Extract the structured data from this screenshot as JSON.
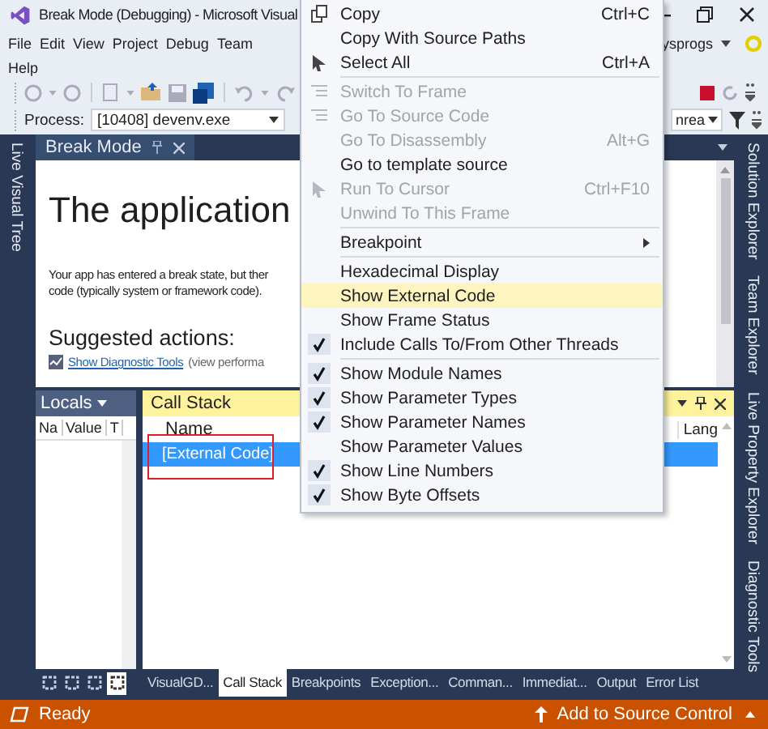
{
  "window": {
    "title": "Break Mode (Debugging) - Microsoft Visual"
  },
  "menu_bar": {
    "items": [
      "File",
      "Edit",
      "View",
      "Project",
      "Debug",
      "Team",
      "Help"
    ],
    "account": "ysprogs"
  },
  "toolbar": {
    "process_label": "Process:",
    "process_value": "[10408] devenv.exe",
    "thread_value": "nrea"
  },
  "left_tool_tabs": [
    "Live Visual Tree"
  ],
  "document": {
    "tab": "Break Mode",
    "heading": "The application",
    "paragraph_lines": [
      "Your app has entered a break state, but ther",
      "code (typically system or framework code)."
    ],
    "subheading": "Suggested actions:",
    "link": "Show Diagnostic Tools",
    "link_note": "(view performa"
  },
  "locals": {
    "title": "Locals",
    "columns": [
      "Na",
      "Value",
      "T"
    ],
    "tabs": [
      {
        "selected": false
      },
      {
        "selected": false
      },
      {
        "selected": false
      },
      {
        "selected": true
      }
    ]
  },
  "call_stack": {
    "title": "Call Stack",
    "columns": [
      "Name",
      "Lang"
    ],
    "rows": [
      {
        "name": "[External Code]",
        "selected": true,
        "outlined": true
      }
    ]
  },
  "bottom_tabs": [
    {
      "label": "VisualGD...",
      "selected": false
    },
    {
      "label": "Call Stack",
      "selected": true
    },
    {
      "label": "Breakpoints",
      "selected": false
    },
    {
      "label": "Exception...",
      "selected": false
    },
    {
      "label": "Comman...",
      "selected": false
    },
    {
      "label": "Immediat...",
      "selected": false
    },
    {
      "label": "Output",
      "selected": false
    },
    {
      "label": "Error List",
      "selected": false
    }
  ],
  "right_tool_tabs": [
    "Solution Explorer",
    "Team Explorer",
    "Live Property Explorer",
    "Diagnostic Tools"
  ],
  "status_bar": {
    "text": "Ready",
    "source_control": "Add to Source Control"
  },
  "context_menu": {
    "items": [
      {
        "kind": "item",
        "label": "Copy",
        "shortcut": "Ctrl+C",
        "disabled": false,
        "selected": false
      },
      {
        "kind": "item",
        "label": "Copy With Source Paths",
        "disabled": false,
        "selected": false
      },
      {
        "kind": "item",
        "label": "Select All",
        "shortcut": "Ctrl+A",
        "disabled": false,
        "selected": false
      },
      {
        "kind": "separator"
      },
      {
        "kind": "item",
        "label": "Switch To Frame",
        "disabled": true,
        "selected": false
      },
      {
        "kind": "item",
        "label": "Go To Source Code",
        "disabled": true,
        "selected": false
      },
      {
        "kind": "item",
        "label": "Go To Disassembly",
        "shortcut": "Alt+G",
        "disabled": true,
        "selected": false
      },
      {
        "kind": "item",
        "label": "Go to template source",
        "disabled": false,
        "selected": false
      },
      {
        "kind": "item",
        "label": "Run To Cursor",
        "shortcut": "Ctrl+F10",
        "disabled": true,
        "selected": false
      },
      {
        "kind": "item",
        "label": "Unwind To This Frame",
        "disabled": true,
        "selected": false
      },
      {
        "kind": "separator"
      },
      {
        "kind": "submenu",
        "label": "Breakpoint",
        "disabled": false,
        "selected": false
      },
      {
        "kind": "separator"
      },
      {
        "kind": "check",
        "label": "Hexadecimal Display",
        "checked": false,
        "selected": false
      },
      {
        "kind": "check",
        "label": "Show External Code",
        "checked": false,
        "selected": true
      },
      {
        "kind": "check",
        "label": "Show Frame Status",
        "checked": false,
        "selected": false
      },
      {
        "kind": "check",
        "label": "Include Calls To/From Other Threads",
        "checked": true,
        "selected": false
      },
      {
        "kind": "separator"
      },
      {
        "kind": "check",
        "label": "Show Module Names",
        "checked": true,
        "selected": false
      },
      {
        "kind": "check",
        "label": "Show Parameter Types",
        "checked": true,
        "selected": false
      },
      {
        "kind": "check",
        "label": "Show Parameter Names",
        "checked": true,
        "selected": false
      },
      {
        "kind": "check",
        "label": "Show Parameter Values",
        "checked": false,
        "selected": false
      },
      {
        "kind": "check",
        "label": "Show Line Numbers",
        "checked": true,
        "selected": false
      },
      {
        "kind": "check",
        "label": "Show Byte Offsets",
        "checked": true,
        "selected": false
      }
    ]
  }
}
